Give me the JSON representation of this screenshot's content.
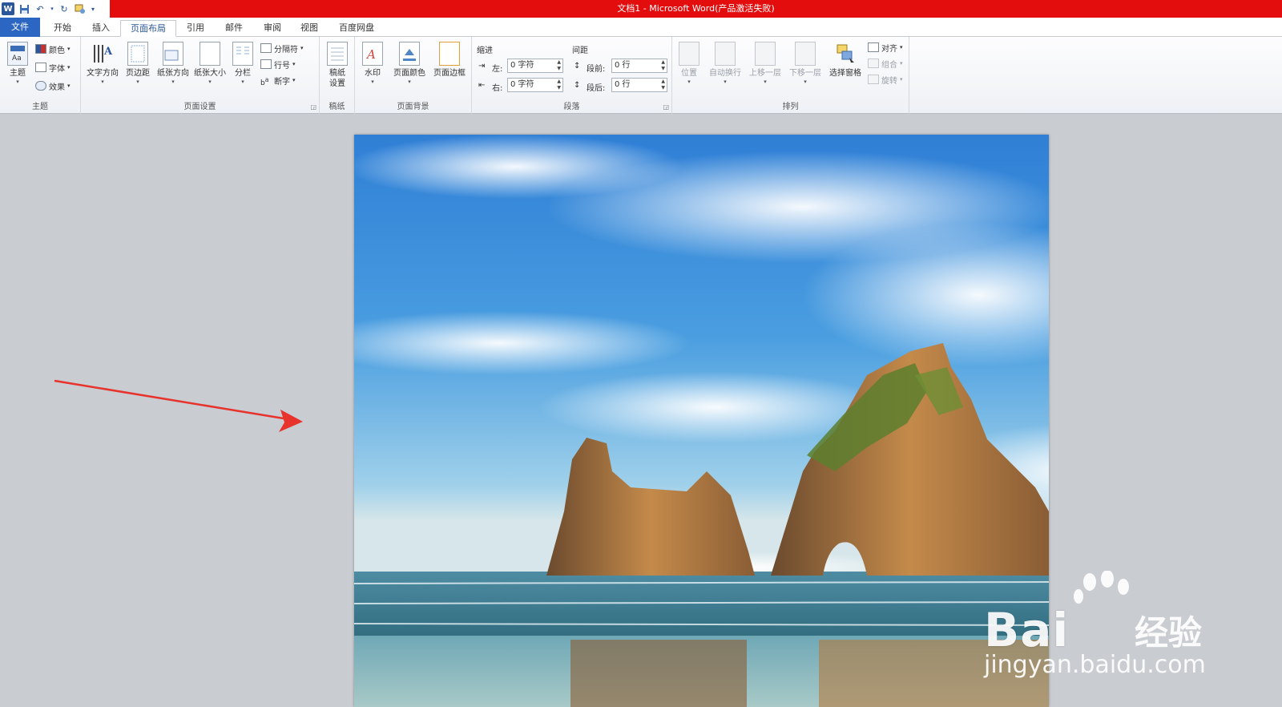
{
  "window": {
    "title": "文档1 - Microsoft Word(产品激活失败)"
  },
  "quick_access": {
    "app_icon": "W"
  },
  "tabs": [
    {
      "label": "文件",
      "kind": "file"
    },
    {
      "label": "开始",
      "kind": "normal"
    },
    {
      "label": "插入",
      "kind": "normal"
    },
    {
      "label": "页面布局",
      "kind": "active"
    },
    {
      "label": "引用",
      "kind": "normal"
    },
    {
      "label": "邮件",
      "kind": "normal"
    },
    {
      "label": "审阅",
      "kind": "normal"
    },
    {
      "label": "视图",
      "kind": "normal"
    },
    {
      "label": "百度网盘",
      "kind": "normal"
    }
  ],
  "ribbon": {
    "theme": {
      "label": "主题",
      "theme_btn": "主题",
      "colors": "颜色",
      "fonts": "字体",
      "effects": "效果"
    },
    "page_setup": {
      "label": "页面设置",
      "text_direction": "文字方向",
      "margins": "页边距",
      "orientation": "纸张方向",
      "size": "纸张大小",
      "columns": "分栏",
      "breaks": "分隔符",
      "line_numbers": "行号",
      "hyphenation": "断字"
    },
    "manuscript": {
      "label": "稿纸",
      "setup_line1": "稿纸",
      "setup_line2": "设置"
    },
    "page_background": {
      "label": "页面背景",
      "watermark": "水印",
      "page_color": "页面颜色",
      "page_borders": "页面边框"
    },
    "paragraph": {
      "label": "段落",
      "indent_header": "缩进",
      "spacing_header": "间距",
      "indent_left_label": "左:",
      "indent_left_value": "0 字符",
      "indent_right_label": "右:",
      "indent_right_value": "0 字符",
      "spacing_before_label": "段前:",
      "spacing_before_value": "0 行",
      "spacing_after_label": "段后:",
      "spacing_after_value": "0 行"
    },
    "arrange": {
      "label": "排列",
      "position": "位置",
      "wrap_text": "自动换行",
      "bring_forward": "上移一层",
      "send_backward": "下移一层",
      "selection_pane": "选择窗格",
      "align": "对齐",
      "group": "组合",
      "rotate": "旋转"
    }
  },
  "watermark_overlay": {
    "brand": "Bai",
    "brand_cn": "经验",
    "url": "jingyan.baidu.com"
  },
  "colors": {
    "title_bar": "#e30d0d",
    "file_tab": "#2b66c2",
    "workspace": "#c9ccd1",
    "annotation_arrow": "#e8322c"
  }
}
